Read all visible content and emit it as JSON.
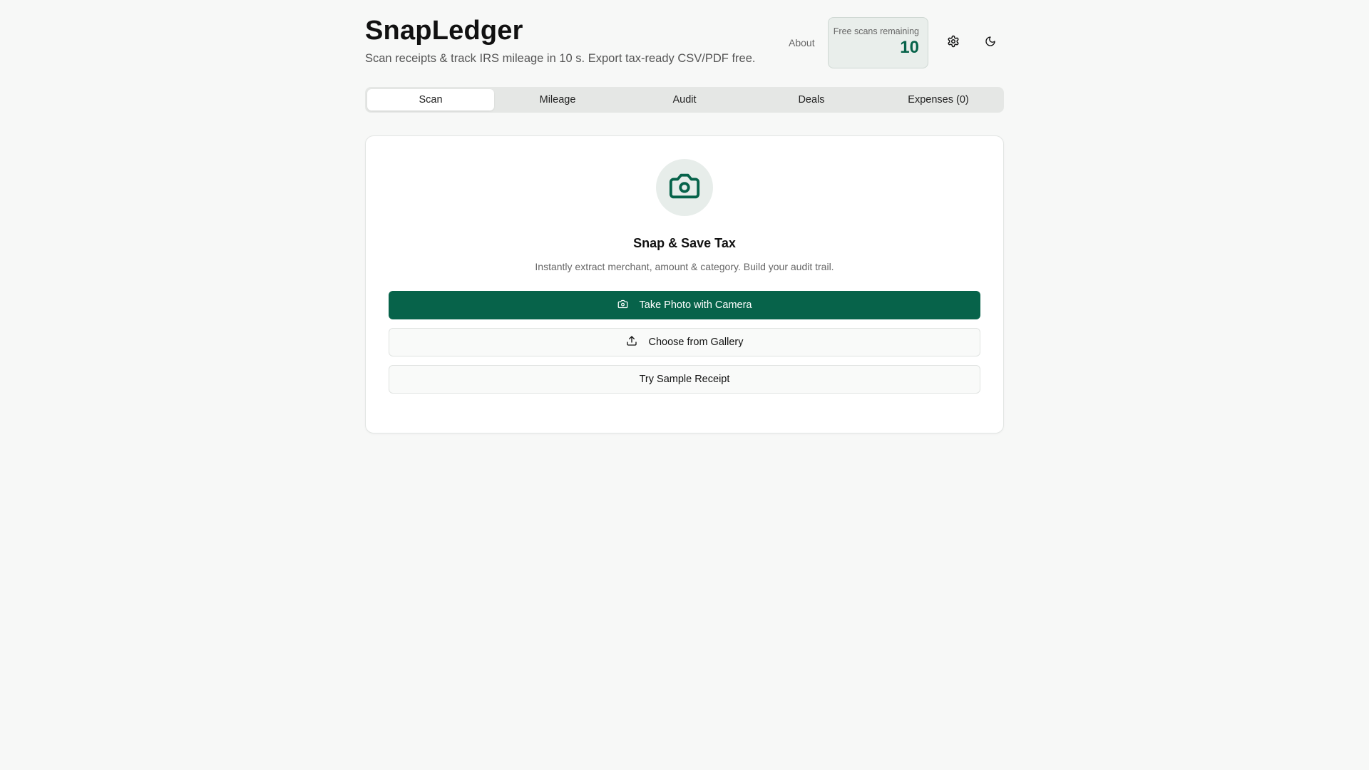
{
  "header": {
    "title": "SnapLedger",
    "subtitle": "Scan receipts & track IRS mileage in 10 s. Export tax-ready CSV/PDF free.",
    "about_label": "About",
    "scans_label": "Free scans remaining",
    "scans_count": "10",
    "settings_icon": "gear-icon",
    "theme_icon": "moon-icon"
  },
  "tabs": [
    {
      "label": "Scan",
      "active": true
    },
    {
      "label": "Mileage",
      "active": false
    },
    {
      "label": "Audit",
      "active": false
    },
    {
      "label": "Deals",
      "active": false
    },
    {
      "label": "Expenses (0)",
      "active": false
    }
  ],
  "scan_card": {
    "icon": "camera-icon",
    "title": "Snap & Save Tax",
    "description": "Instantly extract merchant, amount & category. Build your audit trail.",
    "camera_button_label": "Take Photo with Camera",
    "gallery_button_label": "Choose from Gallery",
    "sample_button_label": "Try Sample Receipt"
  },
  "colors": {
    "brand": "#07634a",
    "background": "#f7f8f7",
    "tab_track": "#e5e7e5",
    "scans_box": "#e9eeeb"
  }
}
